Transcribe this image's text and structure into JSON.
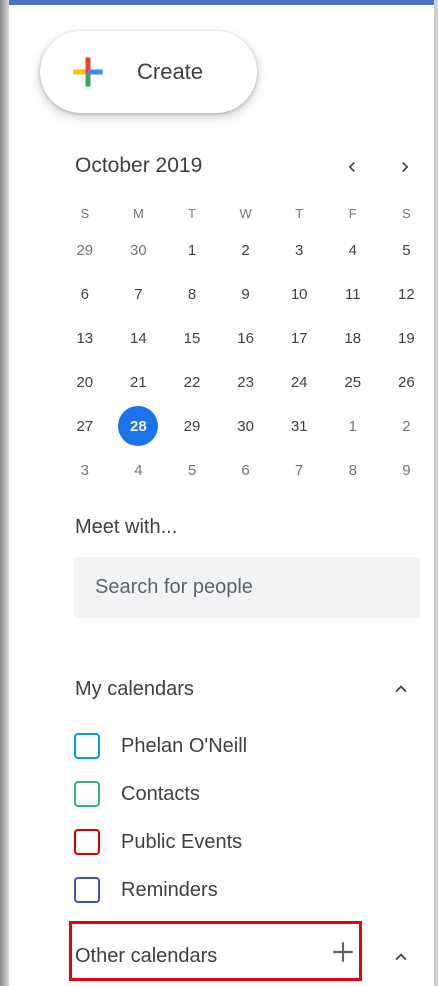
{
  "create": {
    "label": "Create"
  },
  "calendar": {
    "month_label": "October 2019",
    "prev_label": "‹",
    "next_label": "›",
    "weekdays": [
      "S",
      "M",
      "T",
      "W",
      "T",
      "F",
      "S"
    ],
    "weeks": [
      [
        {
          "d": "29",
          "o": true
        },
        {
          "d": "30",
          "o": true
        },
        {
          "d": "1"
        },
        {
          "d": "2"
        },
        {
          "d": "3"
        },
        {
          "d": "4"
        },
        {
          "d": "5"
        }
      ],
      [
        {
          "d": "6"
        },
        {
          "d": "7"
        },
        {
          "d": "8"
        },
        {
          "d": "9"
        },
        {
          "d": "10"
        },
        {
          "d": "11"
        },
        {
          "d": "12"
        }
      ],
      [
        {
          "d": "13"
        },
        {
          "d": "14"
        },
        {
          "d": "15"
        },
        {
          "d": "16"
        },
        {
          "d": "17"
        },
        {
          "d": "18"
        },
        {
          "d": "19"
        }
      ],
      [
        {
          "d": "20"
        },
        {
          "d": "21"
        },
        {
          "d": "22"
        },
        {
          "d": "23"
        },
        {
          "d": "24"
        },
        {
          "d": "25"
        },
        {
          "d": "26"
        }
      ],
      [
        {
          "d": "27"
        },
        {
          "d": "28",
          "today": true
        },
        {
          "d": "29"
        },
        {
          "d": "30"
        },
        {
          "d": "31"
        },
        {
          "d": "1",
          "o": true
        },
        {
          "d": "2",
          "o": true
        }
      ],
      [
        {
          "d": "3",
          "o": true
        },
        {
          "d": "4",
          "o": true
        },
        {
          "d": "5",
          "o": true
        },
        {
          "d": "6",
          "o": true
        },
        {
          "d": "7",
          "o": true
        },
        {
          "d": "8",
          "o": true
        },
        {
          "d": "9",
          "o": true
        }
      ]
    ]
  },
  "meet": {
    "title": "Meet with...",
    "search_placeholder": "Search for people"
  },
  "my_calendars": {
    "title": "My calendars",
    "items": [
      {
        "label": "Phelan O'Neill",
        "color": "#039be5"
      },
      {
        "label": "Contacts",
        "color": "#33b679"
      },
      {
        "label": "Public Events",
        "color": "#d50000"
      },
      {
        "label": "Reminders",
        "color": "#3f51b5"
      }
    ]
  },
  "other_calendars": {
    "title": "Other calendars",
    "highlight_color": "#e0060f"
  },
  "icons": {
    "create": "plus-multicolor-icon",
    "expand": "chevron-up-icon",
    "add": "plus-icon"
  }
}
